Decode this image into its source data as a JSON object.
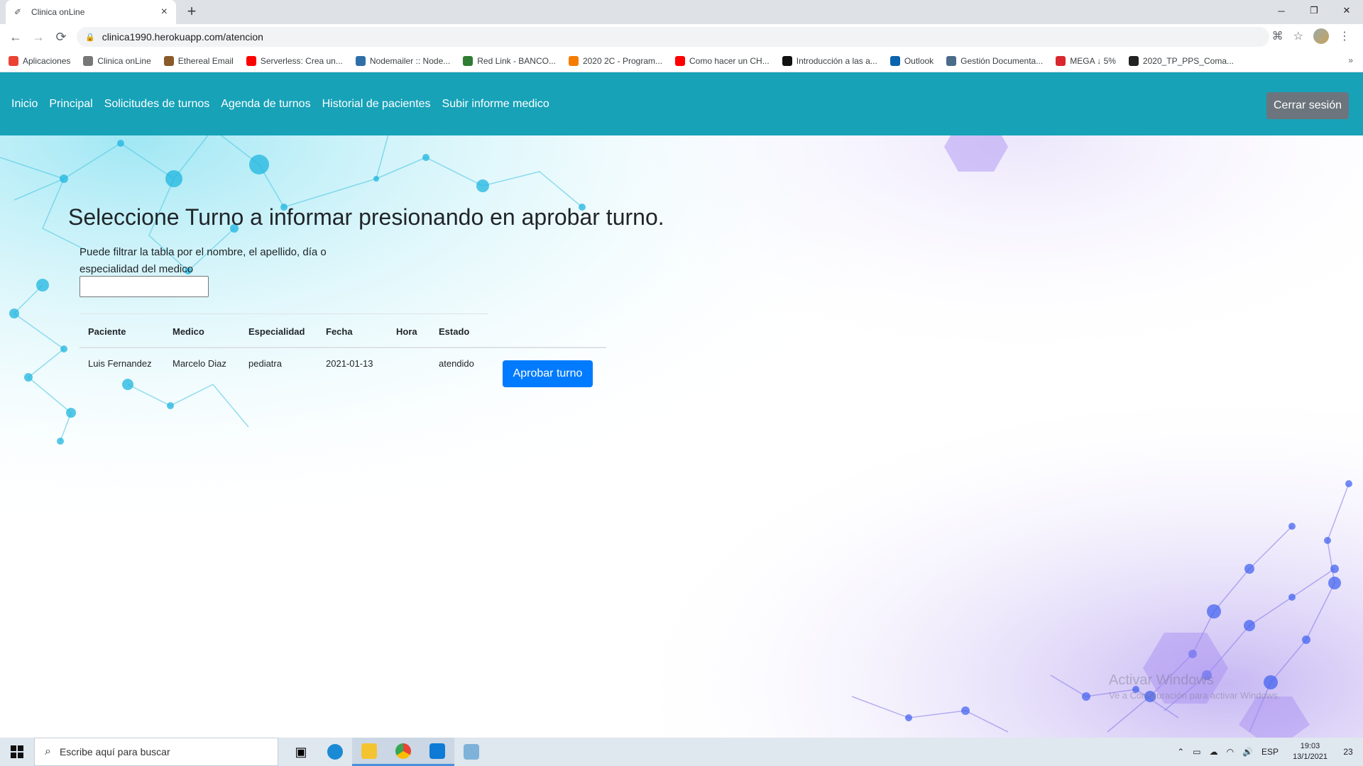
{
  "browser": {
    "tab_title": "Clinica onLine",
    "url": "clinica1990.herokuapp.com/atencion",
    "bookmarks": [
      {
        "label": "Aplicaciones",
        "color": "#ea4335"
      },
      {
        "label": "Clinica onLine",
        "color": "#777777"
      },
      {
        "label": "Ethereal Email",
        "color": "#8a5a2b"
      },
      {
        "label": "Serverless: Crea un...",
        "color": "#ff0000"
      },
      {
        "label": "Nodemailer :: Node...",
        "color": "#2f6fa8"
      },
      {
        "label": "Red Link - BANCO...",
        "color": "#2e7d32"
      },
      {
        "label": "2020 2C - Program...",
        "color": "#f57c00"
      },
      {
        "label": "Como hacer un CH...",
        "color": "#ff0000"
      },
      {
        "label": "Introducción a las a...",
        "color": "#111111"
      },
      {
        "label": "Outlook",
        "color": "#0a64ad"
      },
      {
        "label": "Gestión Documenta...",
        "color": "#4a6b8a"
      },
      {
        "label": "MEGA ↓ 5%",
        "color": "#d9272e"
      },
      {
        "label": "2020_TP_PPS_Coma...",
        "color": "#222222"
      }
    ],
    "bookmarks_more": "»"
  },
  "navbar": {
    "links": [
      "Inicio",
      "Principal",
      "Solicitudes de turnos",
      "Agenda de turnos",
      "Historial de pacientes",
      "Subir informe medico"
    ],
    "logout_label": "Cerrar sesión",
    "color": "#17a2b8"
  },
  "main": {
    "heading": "Seleccione Turno a informar presionando en aprobar turno.",
    "filter_label": "Puede filtrar la tabla por el nombre, el apellido, día o especialidad del medico",
    "filter_value": "",
    "table": {
      "headers": [
        "Paciente",
        "Medico",
        "Especialidad",
        "Fecha",
        "Hora",
        "Estado"
      ],
      "rows": [
        {
          "paciente": "Luis Fernandez",
          "medico": "Marcelo Diaz",
          "especialidad": "pediatra",
          "fecha": "2021-01-13",
          "hora": "",
          "estado": "atendido",
          "action": "Aprobar turno"
        }
      ]
    },
    "button_color": "#007bff"
  },
  "watermark": {
    "line1": "Activar Windows",
    "line2": "Ve a Configuración para activar Windows."
  },
  "taskbar": {
    "search_placeholder": "Escribe aquí para buscar",
    "lang": "ESP",
    "time": "19:03",
    "date": "13/1/2021",
    "notifications": "23"
  }
}
